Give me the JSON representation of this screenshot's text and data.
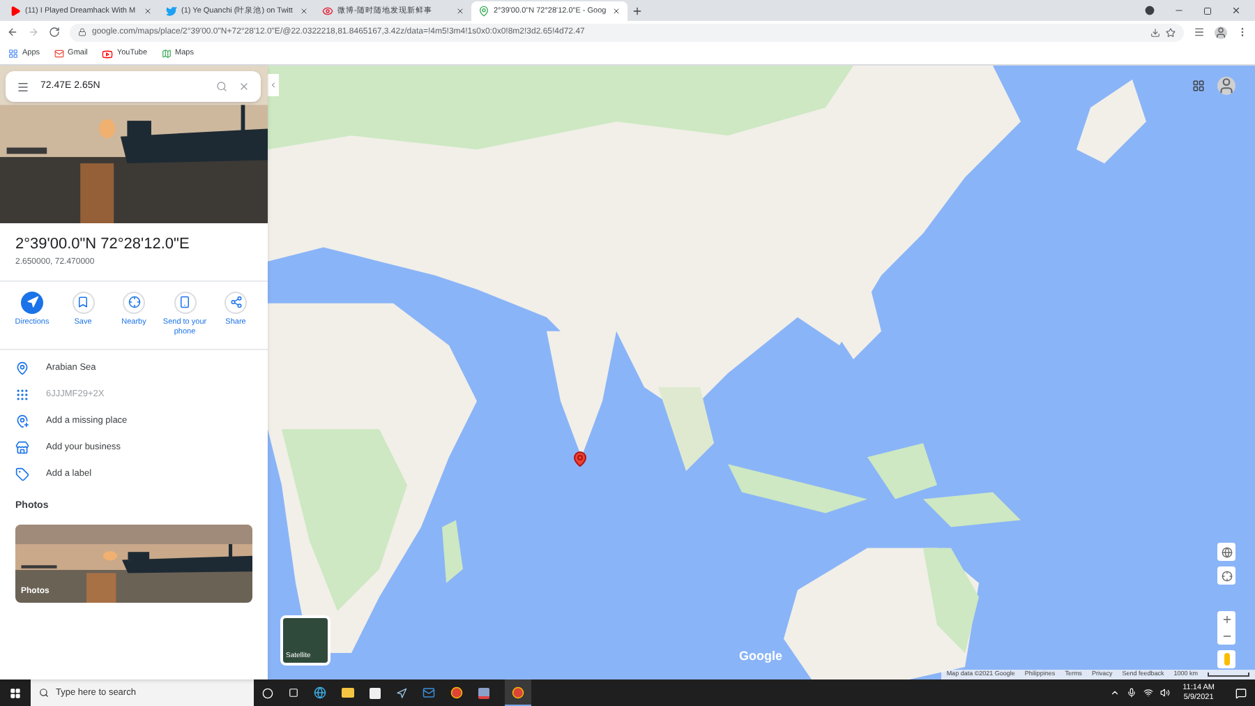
{
  "browser": {
    "tabs": [
      {
        "title": "(11) I Played Dreamhack With M",
        "kind": "video",
        "selected": false
      },
      {
        "title": "(1) Ye Quanchi (叶泉池) on Twitt",
        "kind": "bird",
        "selected": false
      },
      {
        "title": "微博-随时随地发现新鲜事",
        "kind": "eye",
        "selected": false
      },
      {
        "title": "2°39'00.0\"N 72°28'12.0\"E - Goog",
        "kind": "maps",
        "selected": true
      }
    ],
    "url": "google.com/maps/place/2°39'00.0\"N+72°28'12.0\"E/@22.0322218,81.8465167,3.42z/data=!4m5!3m4!1s0x0:0x0!8m2!3d2.65!4d72.47",
    "bookmarks": [
      {
        "label": "Apps",
        "kind": "grid"
      },
      {
        "label": "Gmail",
        "kind": "mail"
      },
      {
        "label": "YouTube",
        "kind": "video"
      },
      {
        "label": "Maps",
        "kind": "maps"
      }
    ]
  },
  "side_panel": {
    "search": {
      "value": "72.47E 2.65N"
    },
    "place": {
      "title": "2°39'00.0\"N 72°28'12.0\"E",
      "coordinates": "2.650000, 72.470000"
    },
    "actions": [
      {
        "label": "Directions",
        "kind": "directions"
      },
      {
        "label": "Save",
        "kind": "save"
      },
      {
        "label": "Nearby",
        "kind": "nearby"
      },
      {
        "label": "Send to your phone",
        "kind": "phone"
      },
      {
        "label": "Share",
        "kind": "share"
      }
    ],
    "details": [
      {
        "label": "Arabian Sea",
        "kind": "place"
      },
      {
        "label": "6JJJMF29+2X",
        "kind": "pluscode"
      },
      {
        "label": "Add a missing place",
        "kind": "addplace"
      },
      {
        "label": "Add your business",
        "kind": "business"
      },
      {
        "label": "Add a label",
        "kind": "label"
      }
    ],
    "photos_heading": "Photos",
    "photo_label": "Photos"
  },
  "map": {
    "satellite_label": "Satellite",
    "logo": "Google",
    "footer": [
      "Map data ©2021 Google",
      "Philippines",
      "Terms",
      "Privacy",
      "Send feedback"
    ],
    "scale": "1000 km"
  },
  "taskbar": {
    "search_placeholder": "Type here to search",
    "time": "11:14 AM",
    "date": "5/9/2021"
  }
}
